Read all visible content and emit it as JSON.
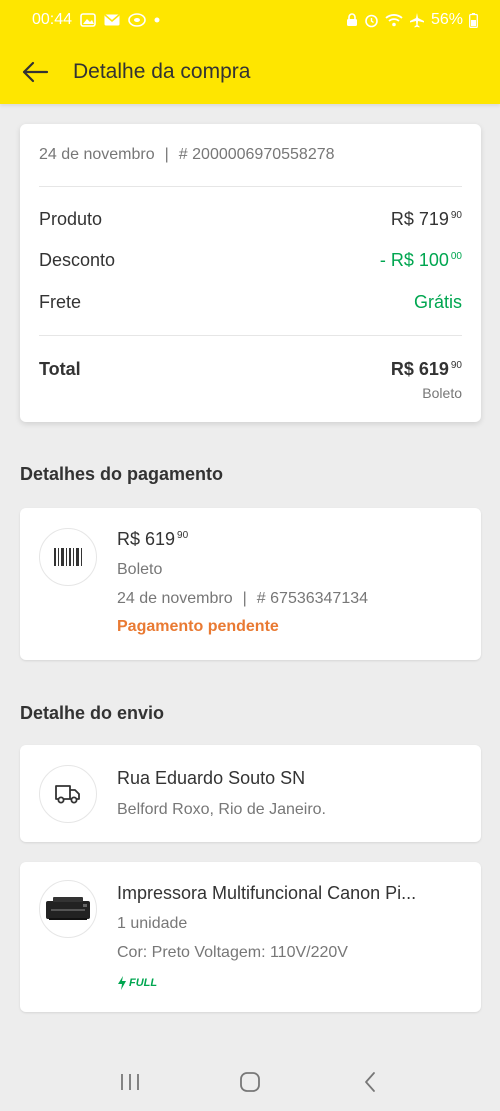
{
  "status_bar": {
    "time": "00:44",
    "battery": "56%"
  },
  "header": {
    "title": "Detalhe da compra"
  },
  "summary": {
    "date": "24 de novembro",
    "separator": "|",
    "order_number": "# 2000006970558278",
    "produto_label": "Produto",
    "produto_value": "R$ 719",
    "produto_cents": "90",
    "desconto_label": "Desconto",
    "desconto_value": "- R$ 100",
    "desconto_cents": "00",
    "frete_label": "Frete",
    "frete_value": "Grátis",
    "total_label": "Total",
    "total_value": "R$ 619",
    "total_cents": "90",
    "total_method": "Boleto"
  },
  "payment": {
    "section_title": "Detalhes do pagamento",
    "amount": "R$ 619",
    "amount_cents": "90",
    "method": "Boleto",
    "date": "24 de novembro",
    "separator": "|",
    "ref": "# 67536347134",
    "status": "Pagamento pendente"
  },
  "shipping": {
    "section_title": "Detalhe do envio",
    "street": "Rua Eduardo Souto SN",
    "city": "Belford Roxo, Rio de Janeiro."
  },
  "product": {
    "name": "Impressora Multifuncional Canon Pi...",
    "quantity": "1 unidade",
    "variant": "Cor: Preto Voltagem: 110V/220V",
    "badge": "FULL"
  },
  "colors": {
    "brand_yellow": "#fee600",
    "green": "#00a650",
    "orange": "#e97a33"
  }
}
